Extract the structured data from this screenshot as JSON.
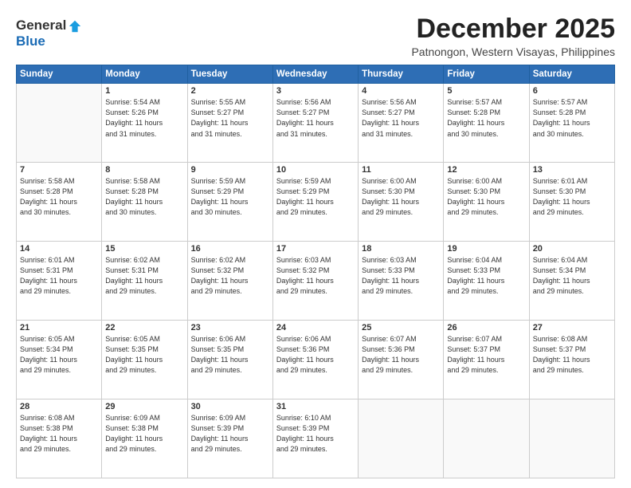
{
  "header": {
    "logo_line1": "General",
    "logo_line2": "Blue",
    "month_title": "December 2025",
    "location": "Patnongon, Western Visayas, Philippines"
  },
  "columns": [
    "Sunday",
    "Monday",
    "Tuesday",
    "Wednesday",
    "Thursday",
    "Friday",
    "Saturday"
  ],
  "weeks": [
    [
      {
        "day": "",
        "info": ""
      },
      {
        "day": "1",
        "info": "Sunrise: 5:54 AM\nSunset: 5:26 PM\nDaylight: 11 hours\nand 31 minutes."
      },
      {
        "day": "2",
        "info": "Sunrise: 5:55 AM\nSunset: 5:27 PM\nDaylight: 11 hours\nand 31 minutes."
      },
      {
        "day": "3",
        "info": "Sunrise: 5:56 AM\nSunset: 5:27 PM\nDaylight: 11 hours\nand 31 minutes."
      },
      {
        "day": "4",
        "info": "Sunrise: 5:56 AM\nSunset: 5:27 PM\nDaylight: 11 hours\nand 31 minutes."
      },
      {
        "day": "5",
        "info": "Sunrise: 5:57 AM\nSunset: 5:28 PM\nDaylight: 11 hours\nand 30 minutes."
      },
      {
        "day": "6",
        "info": "Sunrise: 5:57 AM\nSunset: 5:28 PM\nDaylight: 11 hours\nand 30 minutes."
      }
    ],
    [
      {
        "day": "7",
        "info": "Sunrise: 5:58 AM\nSunset: 5:28 PM\nDaylight: 11 hours\nand 30 minutes."
      },
      {
        "day": "8",
        "info": "Sunrise: 5:58 AM\nSunset: 5:28 PM\nDaylight: 11 hours\nand 30 minutes."
      },
      {
        "day": "9",
        "info": "Sunrise: 5:59 AM\nSunset: 5:29 PM\nDaylight: 11 hours\nand 30 minutes."
      },
      {
        "day": "10",
        "info": "Sunrise: 5:59 AM\nSunset: 5:29 PM\nDaylight: 11 hours\nand 29 minutes."
      },
      {
        "day": "11",
        "info": "Sunrise: 6:00 AM\nSunset: 5:30 PM\nDaylight: 11 hours\nand 29 minutes."
      },
      {
        "day": "12",
        "info": "Sunrise: 6:00 AM\nSunset: 5:30 PM\nDaylight: 11 hours\nand 29 minutes."
      },
      {
        "day": "13",
        "info": "Sunrise: 6:01 AM\nSunset: 5:30 PM\nDaylight: 11 hours\nand 29 minutes."
      }
    ],
    [
      {
        "day": "14",
        "info": "Sunrise: 6:01 AM\nSunset: 5:31 PM\nDaylight: 11 hours\nand 29 minutes."
      },
      {
        "day": "15",
        "info": "Sunrise: 6:02 AM\nSunset: 5:31 PM\nDaylight: 11 hours\nand 29 minutes."
      },
      {
        "day": "16",
        "info": "Sunrise: 6:02 AM\nSunset: 5:32 PM\nDaylight: 11 hours\nand 29 minutes."
      },
      {
        "day": "17",
        "info": "Sunrise: 6:03 AM\nSunset: 5:32 PM\nDaylight: 11 hours\nand 29 minutes."
      },
      {
        "day": "18",
        "info": "Sunrise: 6:03 AM\nSunset: 5:33 PM\nDaylight: 11 hours\nand 29 minutes."
      },
      {
        "day": "19",
        "info": "Sunrise: 6:04 AM\nSunset: 5:33 PM\nDaylight: 11 hours\nand 29 minutes."
      },
      {
        "day": "20",
        "info": "Sunrise: 6:04 AM\nSunset: 5:34 PM\nDaylight: 11 hours\nand 29 minutes."
      }
    ],
    [
      {
        "day": "21",
        "info": "Sunrise: 6:05 AM\nSunset: 5:34 PM\nDaylight: 11 hours\nand 29 minutes."
      },
      {
        "day": "22",
        "info": "Sunrise: 6:05 AM\nSunset: 5:35 PM\nDaylight: 11 hours\nand 29 minutes."
      },
      {
        "day": "23",
        "info": "Sunrise: 6:06 AM\nSunset: 5:35 PM\nDaylight: 11 hours\nand 29 minutes."
      },
      {
        "day": "24",
        "info": "Sunrise: 6:06 AM\nSunset: 5:36 PM\nDaylight: 11 hours\nand 29 minutes."
      },
      {
        "day": "25",
        "info": "Sunrise: 6:07 AM\nSunset: 5:36 PM\nDaylight: 11 hours\nand 29 minutes."
      },
      {
        "day": "26",
        "info": "Sunrise: 6:07 AM\nSunset: 5:37 PM\nDaylight: 11 hours\nand 29 minutes."
      },
      {
        "day": "27",
        "info": "Sunrise: 6:08 AM\nSunset: 5:37 PM\nDaylight: 11 hours\nand 29 minutes."
      }
    ],
    [
      {
        "day": "28",
        "info": "Sunrise: 6:08 AM\nSunset: 5:38 PM\nDaylight: 11 hours\nand 29 minutes."
      },
      {
        "day": "29",
        "info": "Sunrise: 6:09 AM\nSunset: 5:38 PM\nDaylight: 11 hours\nand 29 minutes."
      },
      {
        "day": "30",
        "info": "Sunrise: 6:09 AM\nSunset: 5:39 PM\nDaylight: 11 hours\nand 29 minutes."
      },
      {
        "day": "31",
        "info": "Sunrise: 6:10 AM\nSunset: 5:39 PM\nDaylight: 11 hours\nand 29 minutes."
      },
      {
        "day": "",
        "info": ""
      },
      {
        "day": "",
        "info": ""
      },
      {
        "day": "",
        "info": ""
      }
    ]
  ]
}
